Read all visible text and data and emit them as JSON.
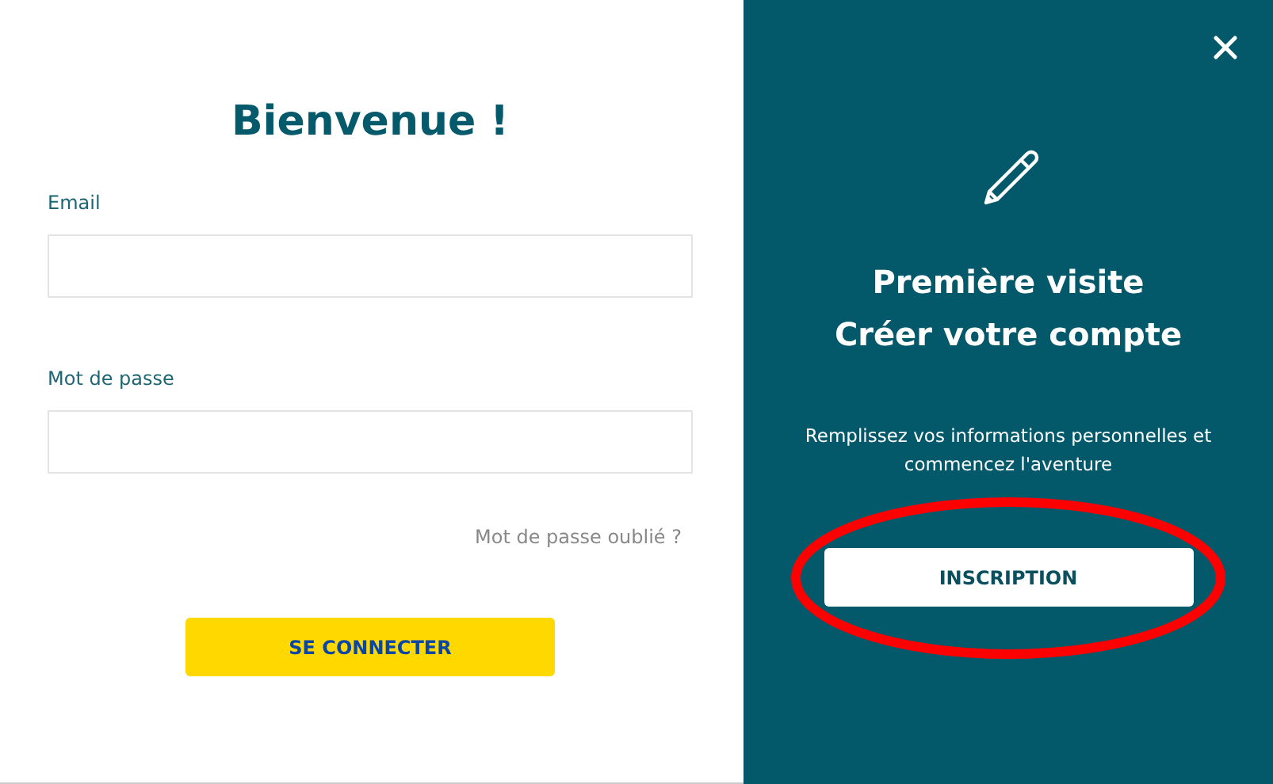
{
  "login": {
    "title": "Bienvenue !",
    "fields": [
      {
        "label": "Email"
      },
      {
        "label": "Mot de passe"
      }
    ],
    "forgot_link": "Mot de passe oublié ?",
    "submit_button": "SE CONNECTER"
  },
  "signup": {
    "heading_lines": [
      "Première visite",
      "Créer votre compte"
    ],
    "description": "Remplissez vos informations personnelles et commencez l'aventure",
    "button": "INSCRIPTION",
    "button_highlighted": true
  }
}
